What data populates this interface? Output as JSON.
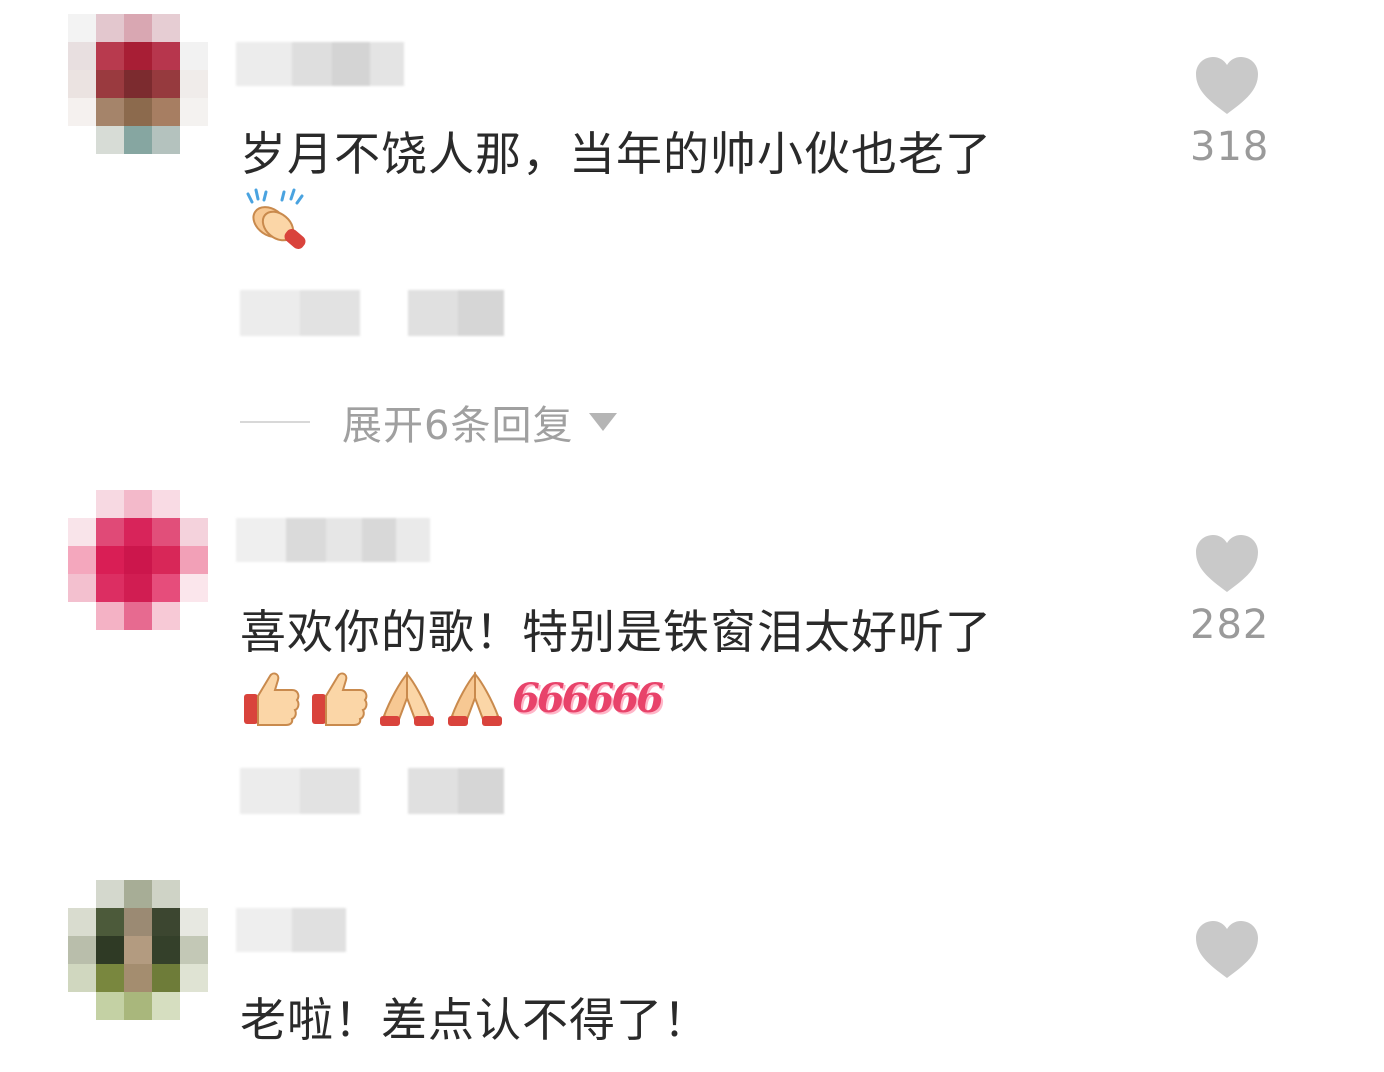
{
  "comments": [
    {
      "text": "岁月不饶人那，当年的帅小伙也老了",
      "emojis": [
        "clapping-hands"
      ],
      "likes": "318",
      "expand_replies": "展开6条回复"
    },
    {
      "text": "喜欢你的歌！特别是铁窗泪太好听了",
      "emojis": [
        "thumbs-up",
        "thumbs-up",
        "folded-hands",
        "folded-hands"
      ],
      "sticker_text": "666666",
      "likes": "282"
    },
    {
      "text": "老啦！差点认不得了！"
    }
  ],
  "colors": {
    "heart": "#c9c9c9",
    "text": "#2a2a2a",
    "count": "#9a9a9a",
    "sticker": "#e8436a"
  }
}
